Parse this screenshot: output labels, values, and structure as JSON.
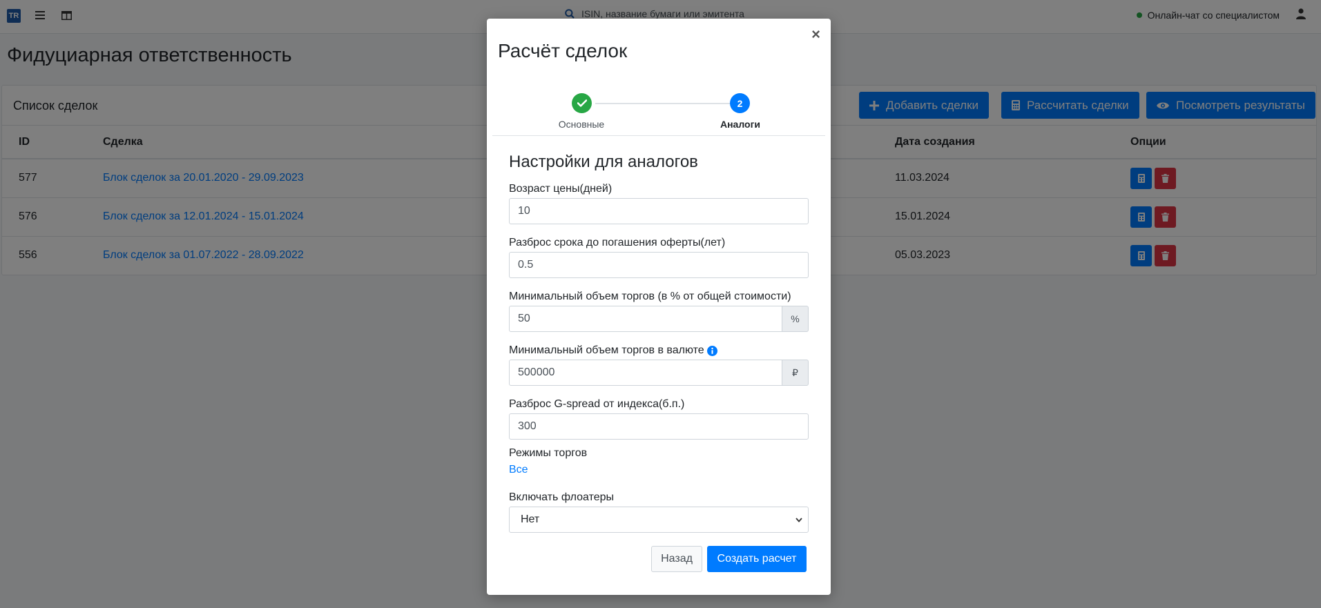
{
  "navbar": {
    "logo_text": "TR",
    "search_placeholder": "ISIN, название бумаги или эмитента",
    "chat_label": "Онлайн-чат со специалистом"
  },
  "page": {
    "title": "Фидуциарная ответственность"
  },
  "card": {
    "title": "Список сделок",
    "buttons": {
      "add": "Добавить сделки",
      "calc": "Рассчитать сделки",
      "results": "Посмотреть результаты"
    },
    "columns": {
      "id": "ID",
      "deal": "Сделка",
      "date": "Дата создания",
      "options": "Опции"
    },
    "rows": [
      {
        "id": "577",
        "deal": "Блок сделок за 20.01.2020 - 29.09.2023",
        "date": "11.03.2024"
      },
      {
        "id": "576",
        "deal": "Блок сделок за 12.01.2024 - 15.01.2024",
        "date": "15.01.2024"
      },
      {
        "id": "556",
        "deal": "Блок сделок за 01.07.2022 - 28.09.2022",
        "date": "05.03.2023"
      }
    ]
  },
  "modal": {
    "title": "Расчёт сделок",
    "close": "×",
    "steps": [
      {
        "label": "Основные",
        "status": "completed"
      },
      {
        "label": "Аналоги",
        "number": "2",
        "status": "active"
      }
    ],
    "section_title": "Настройки для аналогов",
    "fields": {
      "price_age": {
        "label": "Возраст цены(дней)",
        "value": "10"
      },
      "maturity_spread": {
        "label": "Разброс срока до погашения оферты(лет)",
        "value": "0.5"
      },
      "min_volume_pct": {
        "label": "Минимальный объем торгов (в % от общей стоимости)",
        "value": "50",
        "addon": "%"
      },
      "min_volume_currency": {
        "label": "Минимальный объем торгов в валюте",
        "value": "500000",
        "addon": "₽"
      },
      "gspread": {
        "label": "Разброс G-spread от индекса(б.п.)",
        "value": "300"
      },
      "trade_modes": {
        "label": "Режимы торгов",
        "link": "Все"
      },
      "floaters": {
        "label": "Включать флоатеры",
        "value": "Нет"
      }
    },
    "buttons": {
      "back": "Назад",
      "create": "Создать расчет"
    }
  },
  "colors": {
    "primary": "#007bff",
    "success": "#28a745",
    "danger": "#dc3545",
    "backdrop": "rgba(0,0,0,0.5)"
  },
  "icons": [
    "menu-icon",
    "columns-icon",
    "search-icon",
    "user-icon",
    "plus-icon",
    "calculator-icon",
    "eye-icon",
    "trash-icon",
    "check-icon",
    "info-icon",
    "chevron-down-icon"
  ]
}
